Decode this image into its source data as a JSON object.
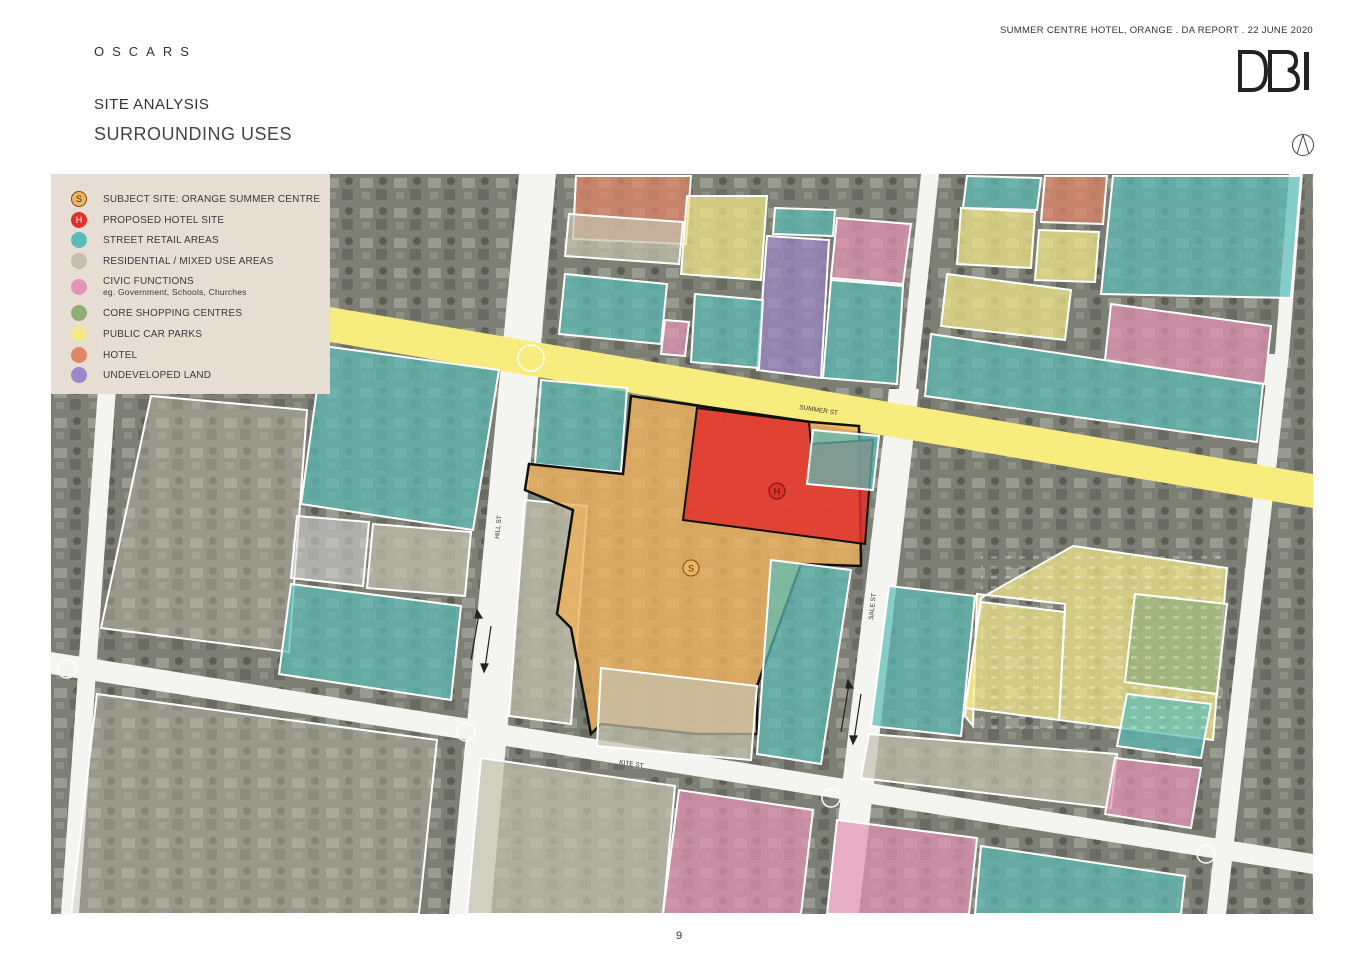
{
  "header": {
    "brand": "OSCARS",
    "report_title": "SUMMER CENTRE HOTEL, ORANGE . DA REPORT . 22 JUNE 2020",
    "logo_text": "DBI",
    "heading": "SITE ANALYSIS",
    "subheading": "SURROUNDING USES"
  },
  "legend": {
    "items": [
      {
        "marker": "S",
        "label": "SUBJECT SITE:  ORANGE SUMMER CENTRE",
        "sublabel": "",
        "color": "#f0b35e"
      },
      {
        "marker": "H",
        "label": "PROPOSED HOTEL SITE",
        "sublabel": "",
        "color": "#e0302c"
      },
      {
        "marker": "",
        "label": "STREET RETAIL AREAS",
        "sublabel": "",
        "color": "#5bbdb7"
      },
      {
        "marker": "",
        "label": "RESIDENTIAL / MIXED USE AREAS",
        "sublabel": "",
        "color": "#c3c1ad"
      },
      {
        "marker": "",
        "label": "CIVIC FUNCTIONS",
        "sublabel": "eg. Government, Schools, Churches",
        "color": "#e393b4"
      },
      {
        "marker": "",
        "label": "CORE SHOPPING CENTRES",
        "sublabel": "",
        "color": "#8fac78"
      },
      {
        "marker": "",
        "label": "PUBLIC CAR PARKS",
        "sublabel": "",
        "color": "#f2e98a"
      },
      {
        "marker": "",
        "label": "HOTEL",
        "sublabel": "",
        "color": "#e2866a"
      },
      {
        "marker": "",
        "label": "UNDEVELOPED LAND",
        "sublabel": "",
        "color": "#9d87c8"
      }
    ]
  },
  "map": {
    "streets": {
      "summer": "SUMMER ST",
      "hill": "HILL ST",
      "kite": "KITE ST",
      "sale": "SALE ST"
    },
    "site_marker": "S",
    "hotel_marker": "H",
    "colors": {
      "highlight_road": "#f7ec7e",
      "subject_site": "#f0b35e",
      "hotel_site": "#e0302c",
      "retail": "#5bbdb7",
      "residential": "#c3c1ad",
      "civic": "#e393b4",
      "shopping": "#8fac78",
      "carpark": "#f2e98a",
      "hotel": "#e2866a",
      "undeveloped": "#9d87c8"
    }
  },
  "footer": {
    "page_number": "9"
  }
}
